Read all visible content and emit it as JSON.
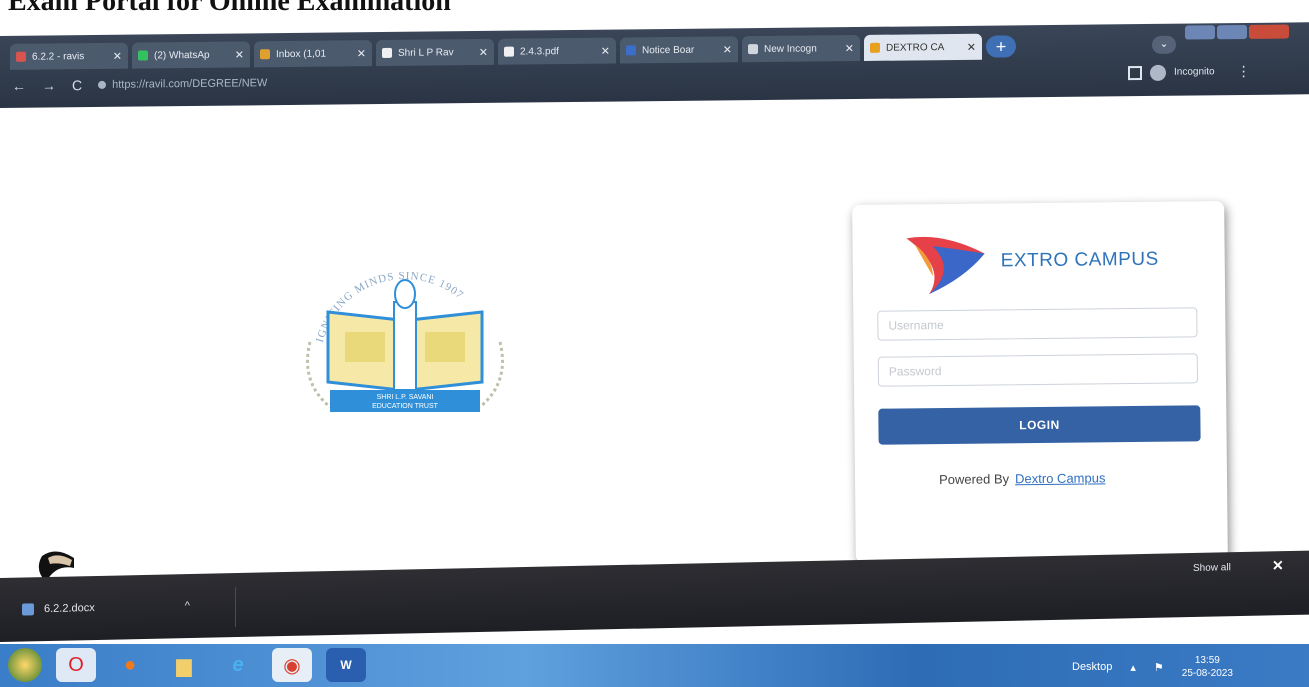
{
  "heading": "Exam Portal for Online  Examination",
  "browser": {
    "tabs": [
      {
        "label": "6.2.2 - ravis",
        "color": "#d9534f"
      },
      {
        "label": "(2) WhatsAp",
        "color": "#35c060"
      },
      {
        "label": "Inbox (1,01",
        "color": "#e0a030"
      },
      {
        "label": "Shri L P Rav",
        "color": "#f0f0f0"
      },
      {
        "label": "2.4.3.pdf",
        "color": "#f0f0f0"
      },
      {
        "label": "Notice Boar",
        "color": "#3b6ec8"
      },
      {
        "label": "New Incogn",
        "color": "#cfd6de"
      },
      {
        "label": "DEXTRO CA",
        "color": "#e8a020"
      }
    ],
    "new_tab": "+",
    "url": "https://ravil.com/DEGREE/NEW",
    "profile_label": "Incognito",
    "back": "←",
    "forward": "→",
    "reload": "C",
    "menu": "⋮"
  },
  "login": {
    "brand_text": "EXTRO CAMPUS",
    "username_placeholder": "Username",
    "password_placeholder": "Password",
    "login_button": "LOGIN",
    "powered_by": "Powered By",
    "powered_link": "Dextro Campus"
  },
  "emblem": {
    "motto": "IGNITING MINDS SINCE 1907",
    "trust_line1": "SHRI L.P. SAVANI",
    "trust_line2": "EDUCATION TRUST"
  },
  "downloads": {
    "file": "6.2.2.docx",
    "show_all": "Show all",
    "close": "✕"
  },
  "taskbar": {
    "desktop_label": "Desktop",
    "time": "13:59",
    "date": "25-08-2023"
  },
  "colors": {
    "login_button": "#3462a4",
    "brand": "#2f73b9",
    "emblem_blue": "#2f8fd8",
    "emblem_yellow": "#f3d36b"
  }
}
